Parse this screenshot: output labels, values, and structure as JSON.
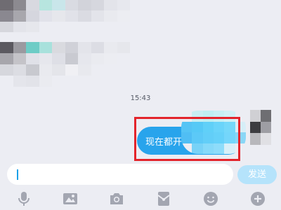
{
  "messages": {
    "timestamp": "15:43",
    "outgoing_text": "现在都开"
  },
  "input": {
    "value": "",
    "placeholder": ""
  },
  "send_label": "发送",
  "toolbar": {
    "icons": [
      "microphone-icon",
      "image-icon",
      "camera-icon",
      "red-packet-icon",
      "emoji-icon",
      "plus-icon"
    ]
  },
  "colors": {
    "accent": "#28a4ec",
    "send_disabled": "#b5e3fb",
    "highlight": "#e3242b",
    "background": "#ecedf3"
  }
}
